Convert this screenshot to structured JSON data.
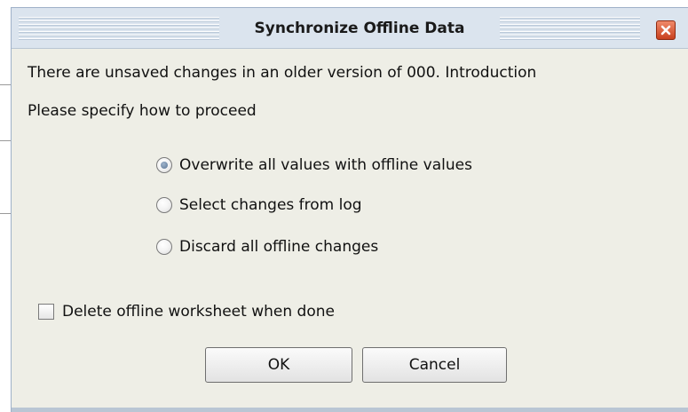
{
  "dialog": {
    "title": "Synchronize Offline Data",
    "close_icon": "close-icon",
    "message_line1": "There are unsaved changes in an older version of 000. Introduction",
    "message_line2": "Please specify how to proceed",
    "options": [
      {
        "label": "Overwrite all values with offline values",
        "selected": true
      },
      {
        "label": "Select changes from log",
        "selected": false
      },
      {
        "label": "Discard all offline changes",
        "selected": false
      }
    ],
    "delete_checkbox": {
      "label": "Delete offline worksheet when done",
      "checked": false
    },
    "ok_label": "OK",
    "cancel_label": "Cancel"
  },
  "colors": {
    "dialog_bg": "#eeeee6",
    "titlebar_bg": "#dbe4ee",
    "close_button": "#d4502c"
  }
}
